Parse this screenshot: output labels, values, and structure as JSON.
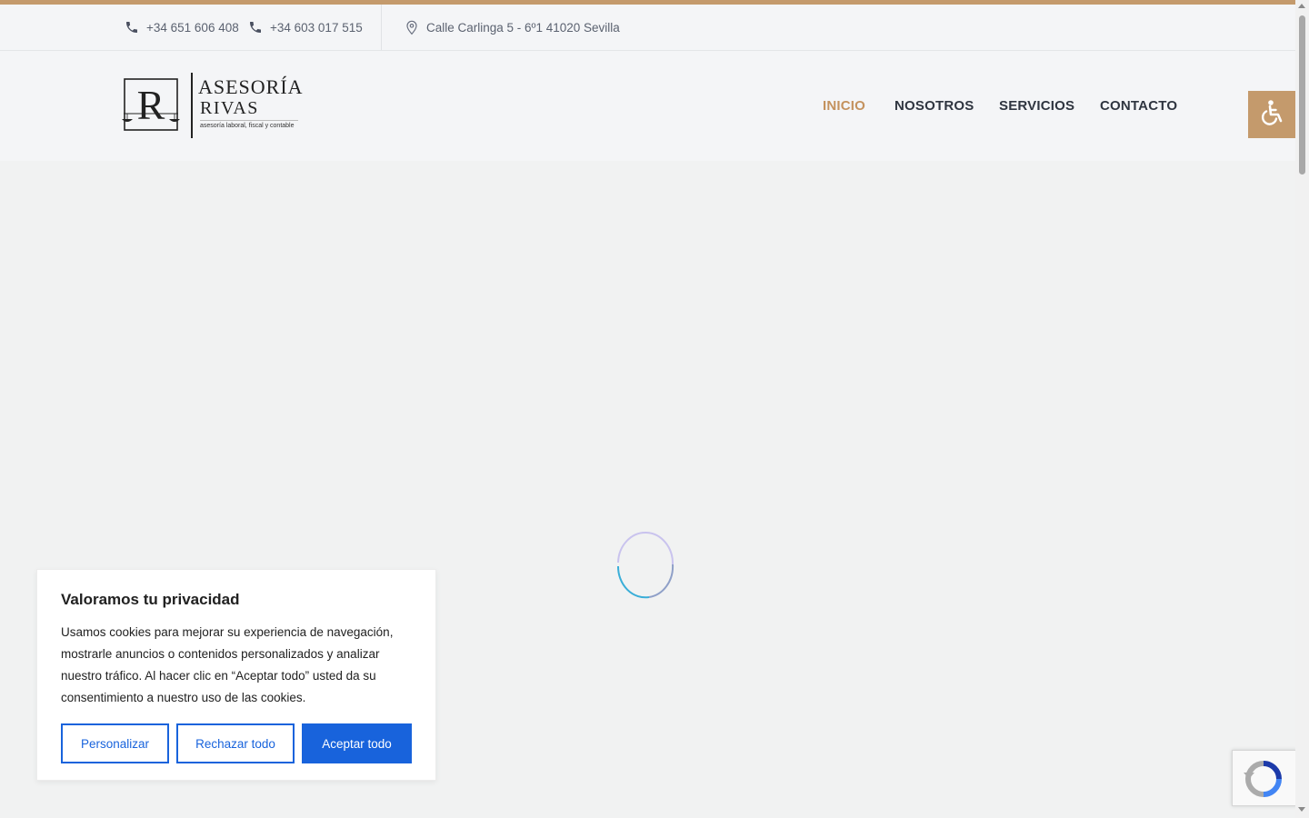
{
  "topbar": {
    "phone1": "+34 651 606 408",
    "phone2": "+34 603 017 515",
    "address": "Calle Carlinga 5 - 6º1 41020 Sevilla",
    "icons": [
      "phone-icon",
      "phone-icon",
      "map-pin-icon"
    ]
  },
  "logo": {
    "monogram": "R",
    "line1": "ASESORÍA",
    "line2": "RIVAS",
    "tagline": "asesoría laboral, fiscal y contable"
  },
  "nav": {
    "items": [
      {
        "label": "INICIO",
        "active": true
      },
      {
        "label": "NOSOTROS",
        "active": false
      },
      {
        "label": "SERVICIOS",
        "active": false
      },
      {
        "label": "CONTACTO",
        "active": false
      }
    ]
  },
  "accessibility": {
    "icon": "wheelchair-icon"
  },
  "cookie_banner": {
    "title": "Valoramos tu privacidad",
    "body": "Usamos cookies para mejorar su experiencia de navegación, mostrarle anuncios o contenidos personalizados y analizar nuestro tráfico. Al hacer clic en “Aceptar todo” usted da su consentimiento a nuestro uso de las cookies.",
    "customize_label": "Personalizar",
    "reject_label": "Rechazar todo",
    "accept_label": "Aceptar todo"
  },
  "colors": {
    "accent": "#c49a6c",
    "nav_active": "#c4925e",
    "nav_text": "#2f3540",
    "cookie_button": "#1863dc"
  }
}
